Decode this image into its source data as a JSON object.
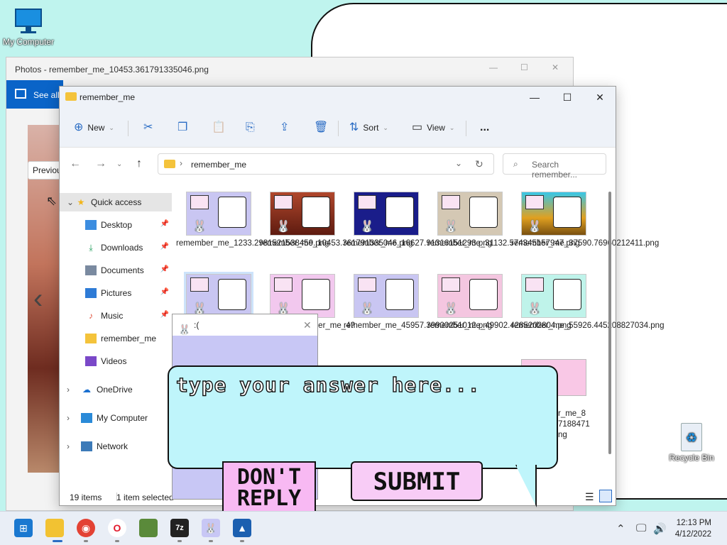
{
  "desktop": {
    "my_computer_label": "My Computer",
    "recycle_bin_label": "Recycle Bin"
  },
  "photos": {
    "title": "Photos - remember_me_10453.361791335046.png",
    "see_all": "See all",
    "previous_tip": "Previous"
  },
  "explorer": {
    "title": "remember_me",
    "commands": {
      "new": "New",
      "sort": "Sort",
      "view": "View",
      "more": "..."
    },
    "address": "remember_me",
    "search_placeholder": "Search remember...",
    "nav": {
      "quick_access": "Quick access",
      "desktop": "Desktop",
      "downloads": "Downloads",
      "documents": "Documents",
      "pictures": "Pictures",
      "music": "Music",
      "remember_me": "remember_me",
      "videos": "Videos",
      "onedrive": "OneDrive",
      "my_computer": "My Computer",
      "network": "Network"
    },
    "files": [
      {
        "name": "remember_me_1233.2981521538459.png"
      },
      {
        "name": "remember_me_10453.361791335046.png"
      },
      {
        "name": "remember_me_16627.91316151293.png"
      },
      {
        "name": "remember_me_31132.574345157947.png"
      },
      {
        "name": "remember_me_37590.76960212411.png"
      },
      {
        "name": ""
      },
      {
        "name": "remember_me_4?2194"
      },
      {
        "name": "remember_me_45957.39900251012.png"
      },
      {
        "name": "remember_me_49902.4285202804.png"
      },
      {
        "name": "remember_me_55926.445208827034.png"
      }
    ],
    "partial_label": "r_me_8",
    "partial_label2": "7188471",
    "partial_label3": "ng",
    "status_items": "19 items",
    "status_selected": "1 item selected"
  },
  "dialog": {
    "title": ":("
  },
  "bubble": {
    "answer_placeholder": "type your answer here...",
    "dont_reply": "DON'T REPLY",
    "submit": "SUBMIT"
  },
  "taskbar": {
    "time": "12:13 PM",
    "date": "4/12/2022"
  },
  "colors": {
    "desktop_bg": "#bff4ee",
    "bubble_bg": "#bff5fb",
    "button_pink": "#f8b9f3",
    "dialog_lavender": "#c8c7f5"
  }
}
